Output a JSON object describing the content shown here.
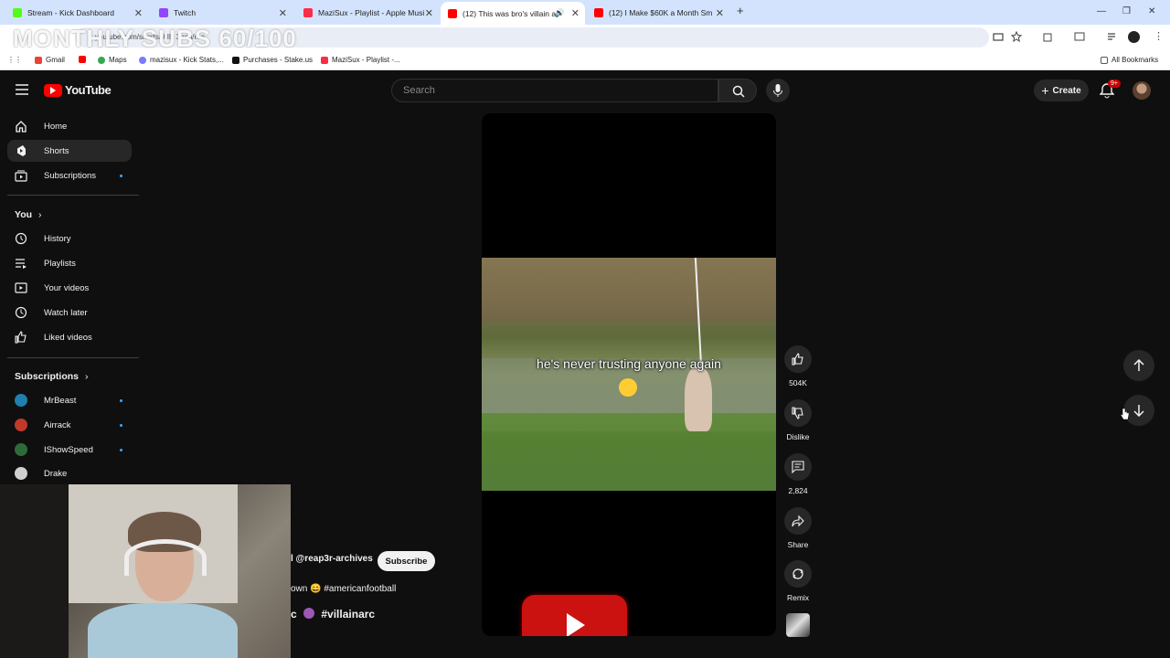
{
  "browser": {
    "tabs": [
      {
        "label": "Stream - Kick Dashboard",
        "color": "#53fc18"
      },
      {
        "label": "Twitch",
        "color": "#9146ff"
      },
      {
        "label": "MaziSux - Playlist - Apple Musi",
        "color": "#fa2d48"
      },
      {
        "label": "(12) This was bro's villain ar",
        "color": "#ff0000"
      },
      {
        "label": "(12) I Make $60K a Month Sm",
        "color": "#ff0000"
      }
    ],
    "address": "youtube.com/shorts/9 IE 3 rcn/rha",
    "bookmarks": [
      "Gmail",
      "Maps",
      "mazisux - Kick Stats,...",
      "Purchases - Stake.us",
      "MaziSux - Playlist -..."
    ],
    "all_bookmarks": "All Bookmarks"
  },
  "overlay": {
    "monthly_subs": "MONTHLY SUBS 60/100"
  },
  "youtube": {
    "logo": "YouTube",
    "search_placeholder": "Search",
    "create_label": "Create",
    "notif_count": "9+"
  },
  "sidebar": {
    "main": [
      {
        "label": "Home",
        "icon": "home-icon"
      },
      {
        "label": "Shorts",
        "icon": "shorts-icon"
      },
      {
        "label": "Subscriptions",
        "icon": "subscriptions-icon"
      }
    ],
    "you_label": "You",
    "you_items": [
      {
        "label": "History"
      },
      {
        "label": "Playlists"
      },
      {
        "label": "Your videos"
      },
      {
        "label": "Watch later"
      },
      {
        "label": "Liked videos"
      }
    ],
    "subs_label": "Subscriptions",
    "subs": [
      {
        "label": "MrBeast",
        "color": "#1f7fb0"
      },
      {
        "label": "Airrack",
        "color": "#c0392b"
      },
      {
        "label": "IShowSpeed",
        "color": "#2e6b3a"
      },
      {
        "label": "Drake",
        "color": "#d0d0d0"
      }
    ]
  },
  "short": {
    "caption": "he's never trusting anyone again",
    "likes": "504K",
    "dislike_label": "Dislike",
    "comments": "2,824",
    "share_label": "Share",
    "remix_label": "Remix",
    "channel": "l @reap3r-archives",
    "subscribe_label": "Subscribe",
    "desc_line1": "own 😄 #americanfootball",
    "desc_line2_prefix": "c",
    "desc_line2_tag": "#villainarc"
  }
}
